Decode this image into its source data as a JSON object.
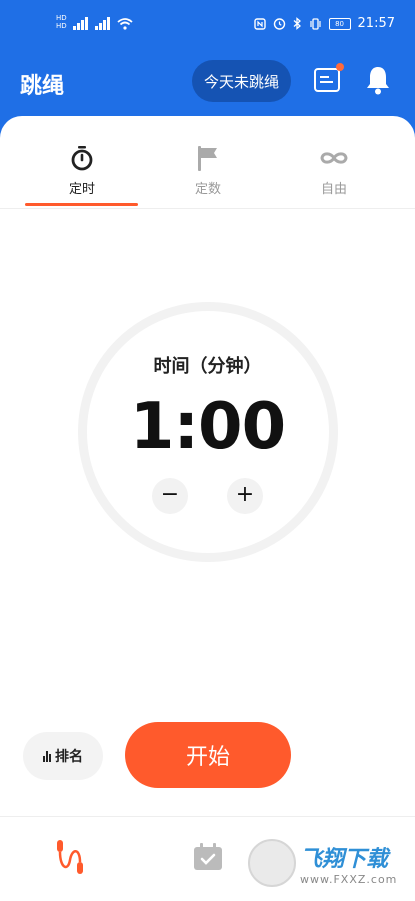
{
  "status_bar": {
    "time": "21:57",
    "left_labels": [
      "HD",
      "HD"
    ],
    "battery": "80"
  },
  "header": {
    "title": "跳绳",
    "today_label": "今天未跳绳"
  },
  "tabs": [
    {
      "label": "定时",
      "icon": "stopwatch-icon",
      "active": true
    },
    {
      "label": "定数",
      "icon": "flag-icon",
      "active": false
    },
    {
      "label": "自由",
      "icon": "infinity-icon",
      "active": false
    }
  ],
  "timer": {
    "caption": "时间（分钟）",
    "value": "1:00",
    "minus": "−",
    "plus": "+"
  },
  "actions": {
    "rank_label": "排名",
    "start_label": "开始"
  },
  "watermark": {
    "main": "飞翔下载",
    "sub": "www.FXXZ.com"
  },
  "colors": {
    "primary": "#1f6fe6",
    "accent": "#ff5a2c"
  }
}
